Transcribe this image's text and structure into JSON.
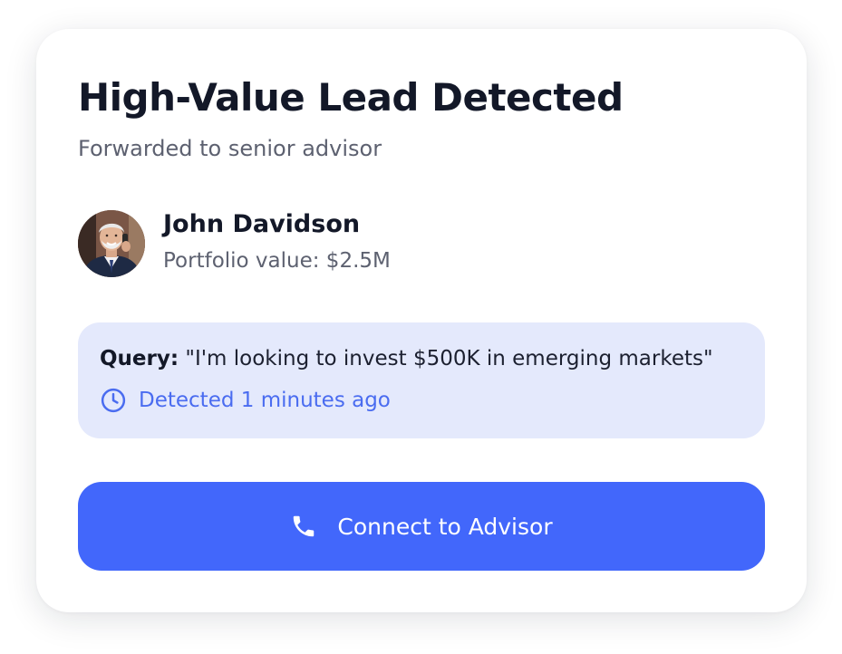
{
  "card": {
    "title": "High-Value Lead Detected",
    "subtitle": "Forwarded to senior advisor"
  },
  "lead": {
    "name": "John Davidson",
    "portfolio": "Portfolio value: $2.5M",
    "avatar_icon": "person-photo-avatar"
  },
  "query": {
    "label": "Query:",
    "text": "\"I'm looking to invest $500K in emerging markets\"",
    "detected": "Detected 1 minutes ago",
    "detected_icon": "clock-icon"
  },
  "action": {
    "button_label": "Connect to Advisor",
    "button_icon": "phone-icon"
  },
  "colors": {
    "accent": "#4267fb",
    "query_bg": "#e4e9fc",
    "detected_text": "#4a6cf0",
    "title_text": "#131828",
    "muted_text": "#5d6170"
  }
}
